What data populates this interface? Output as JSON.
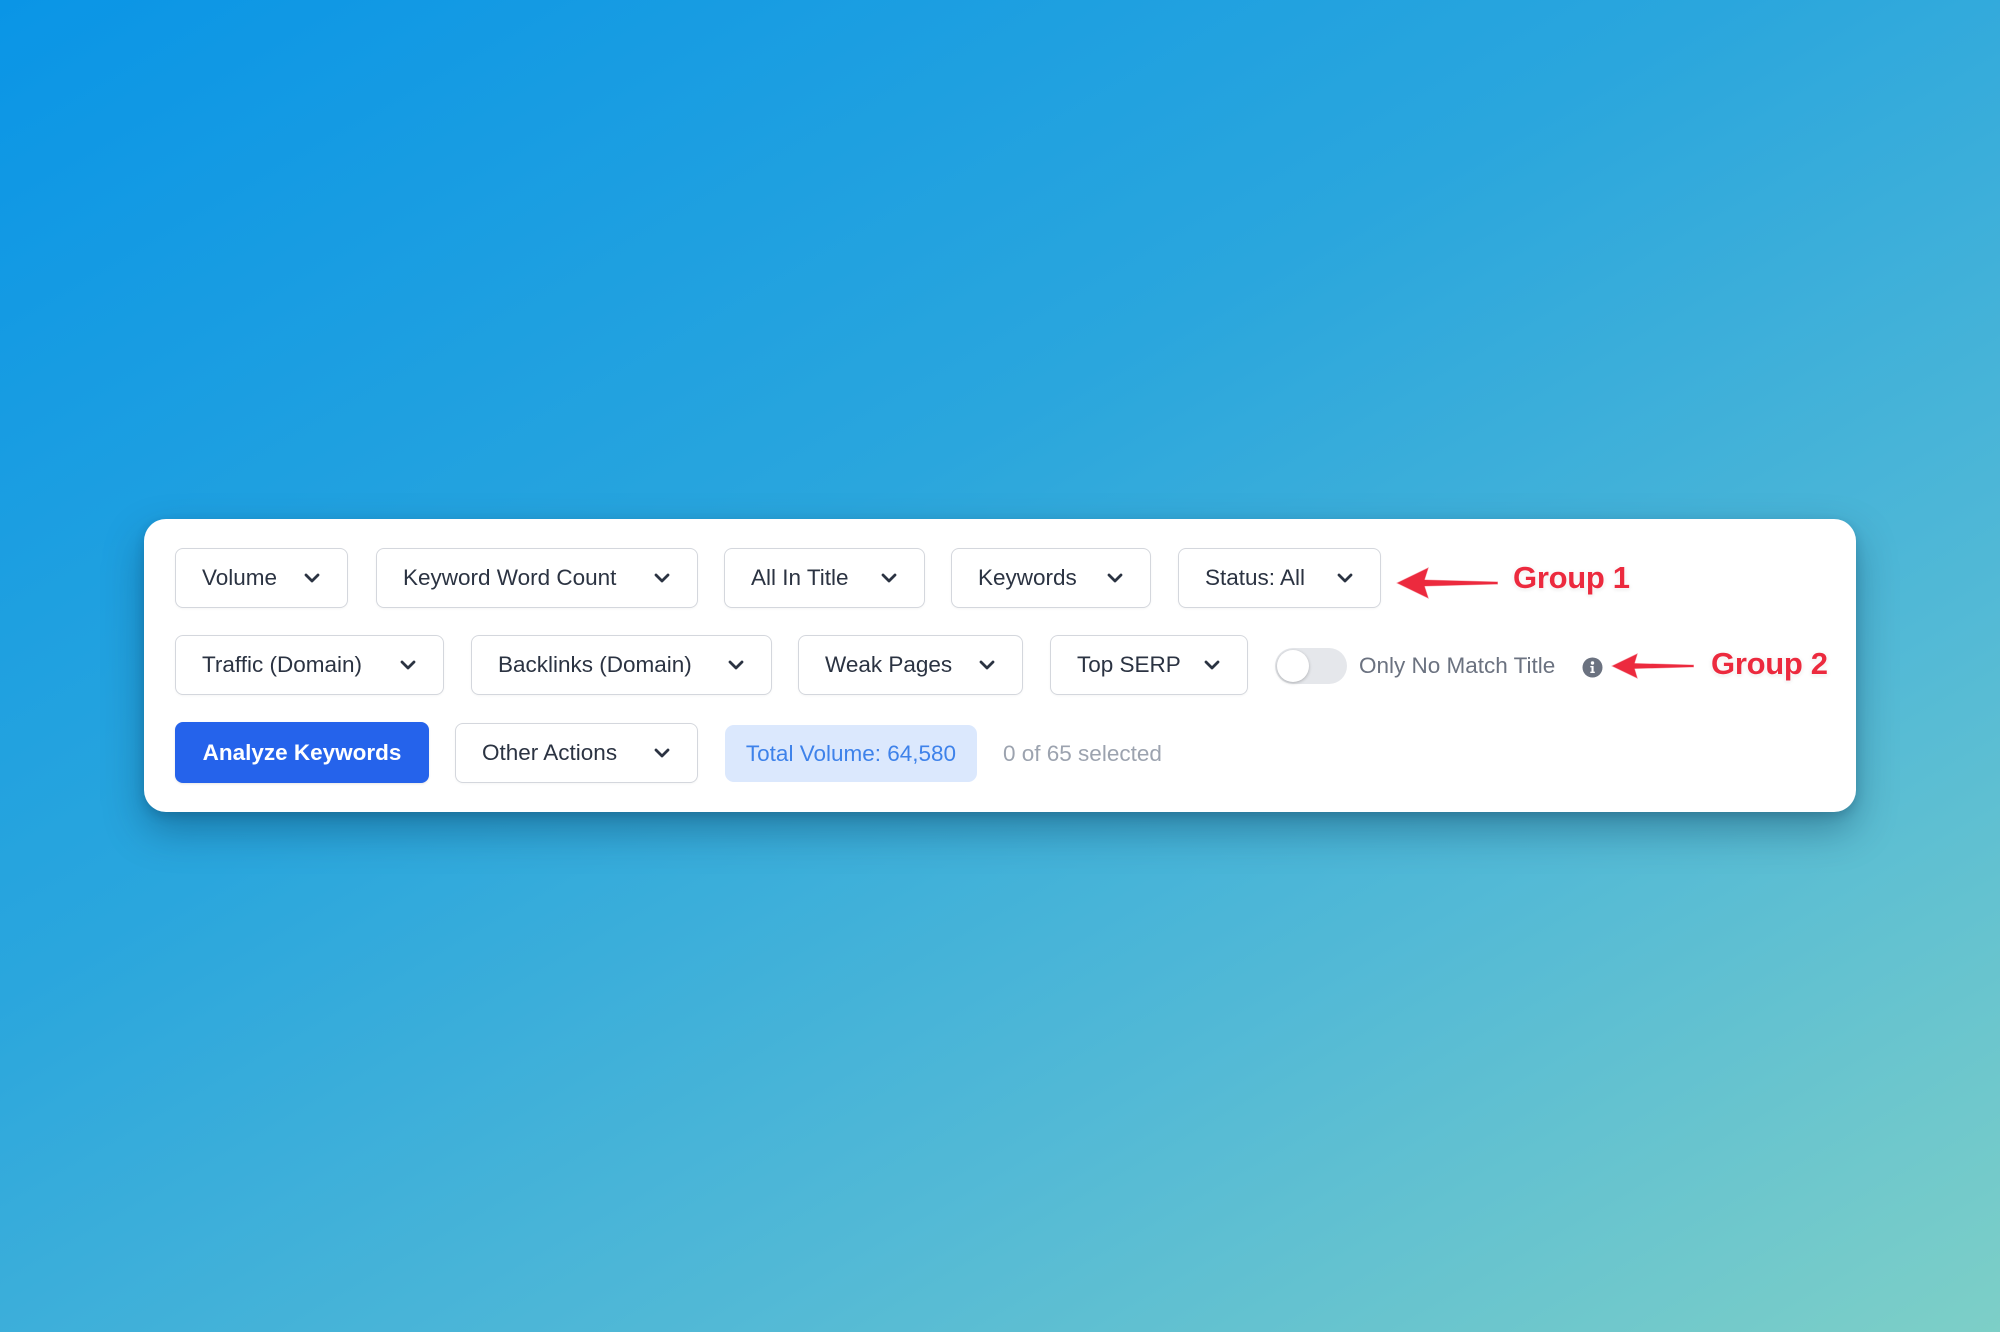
{
  "background": {
    "gradient_start": "#0a95e6",
    "gradient_end": "#7dcfc7"
  },
  "toolbar": {
    "row1": [
      {
        "label": "Volume",
        "icon": "chevron-down-icon"
      },
      {
        "label": "Keyword Word Count",
        "icon": "chevron-down-icon"
      },
      {
        "label": "All In Title",
        "icon": "chevron-down-icon"
      },
      {
        "label": "Keywords",
        "icon": "chevron-down-icon"
      },
      {
        "label": "Status: All",
        "icon": "chevron-down-icon"
      }
    ],
    "row2": [
      {
        "label": "Traffic (Domain)",
        "icon": "chevron-down-icon"
      },
      {
        "label": "Backlinks (Domain)",
        "icon": "chevron-down-icon"
      },
      {
        "label": "Weak Pages",
        "icon": "chevron-down-icon"
      },
      {
        "label": "Top SERP",
        "icon": "chevron-down-icon"
      }
    ],
    "toggle": {
      "label": "Only No Match Title",
      "checked": false,
      "info_icon": "info-circle-icon"
    },
    "row3": {
      "primary_action": "Analyze Keywords",
      "other_actions": "Other Actions",
      "total_volume": "Total Volume: 64,580",
      "selection_status": "0 of 65 selected"
    }
  },
  "annotations": [
    {
      "label": "Group 1",
      "icon": "arrow-left-icon",
      "color": "#ec2a3e"
    },
    {
      "label": "Group 2",
      "icon": "arrow-left-icon",
      "color": "#ec2a3e"
    }
  ],
  "colors": {
    "primary": "#2563eb",
    "pill_bg": "#dbe8fd",
    "pill_text": "#3e82ea",
    "annotation": "#ec2a3e"
  }
}
